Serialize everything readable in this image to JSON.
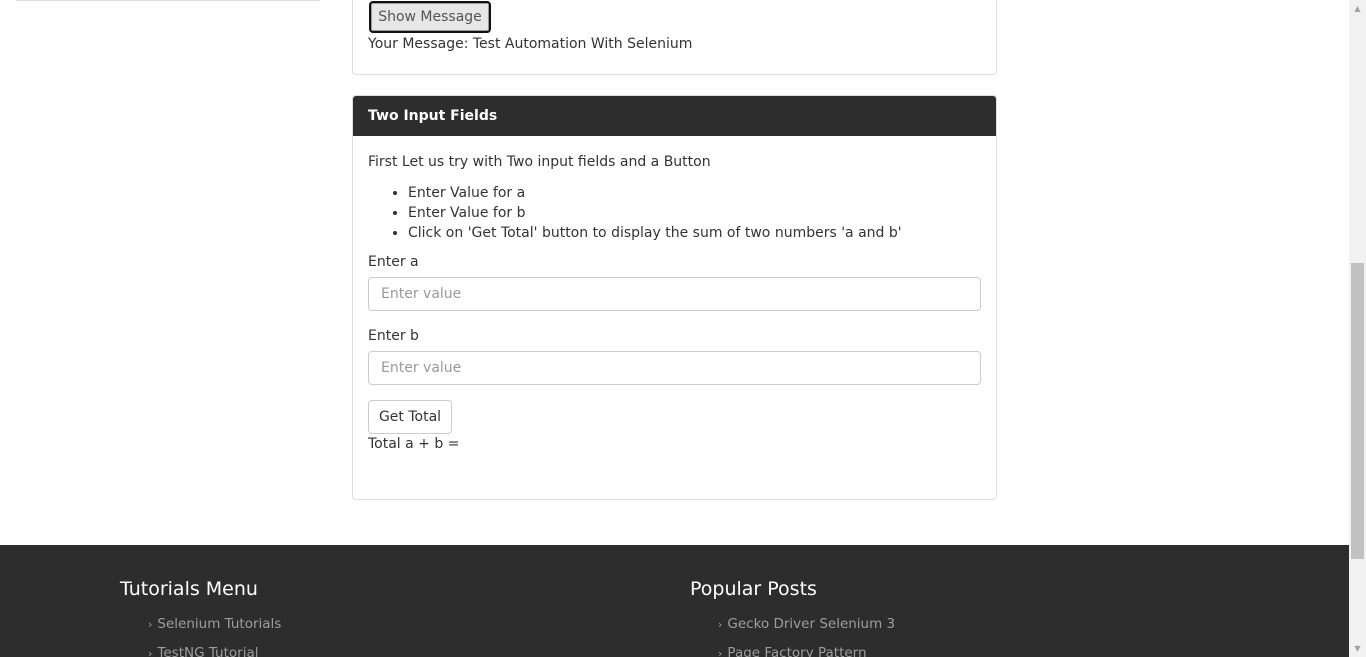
{
  "single_input": {
    "show_button_label": "Show Message",
    "message_prefix": "Your Message:",
    "message_value": "Test Automation With Selenium"
  },
  "two_inputs": {
    "heading": "Two Input Fields",
    "intro": "First Let us try with Two input fields and a Button",
    "steps": [
      "Enter Value for a",
      "Enter Value for b",
      "Click on 'Get Total' button to display the sum of two numbers 'a and b'"
    ],
    "label_a": "Enter a",
    "placeholder_a": "Enter value",
    "value_a": "",
    "label_b": "Enter b",
    "placeholder_b": "Enter value",
    "value_b": "",
    "total_button_label": "Get Total",
    "total_label": "Total a + b =",
    "total_value": ""
  },
  "footer": {
    "tutorials": {
      "title": "Tutorials Menu",
      "items": [
        "Selenium Tutorials",
        "TestNG Tutorial"
      ]
    },
    "popular": {
      "title": "Popular Posts",
      "items": [
        "Gecko Driver Selenium 3",
        "Page Factory Pattern"
      ]
    }
  },
  "colors": {
    "panel_heading_bg": "#2d2d2d",
    "footer_bg": "#2d2d2d",
    "footer_link": "#9d9d9d"
  },
  "icons": {
    "bullet": "chevron-right-icon",
    "scroll_up": "arrow-up-icon",
    "scroll_down": "arrow-down-icon"
  }
}
